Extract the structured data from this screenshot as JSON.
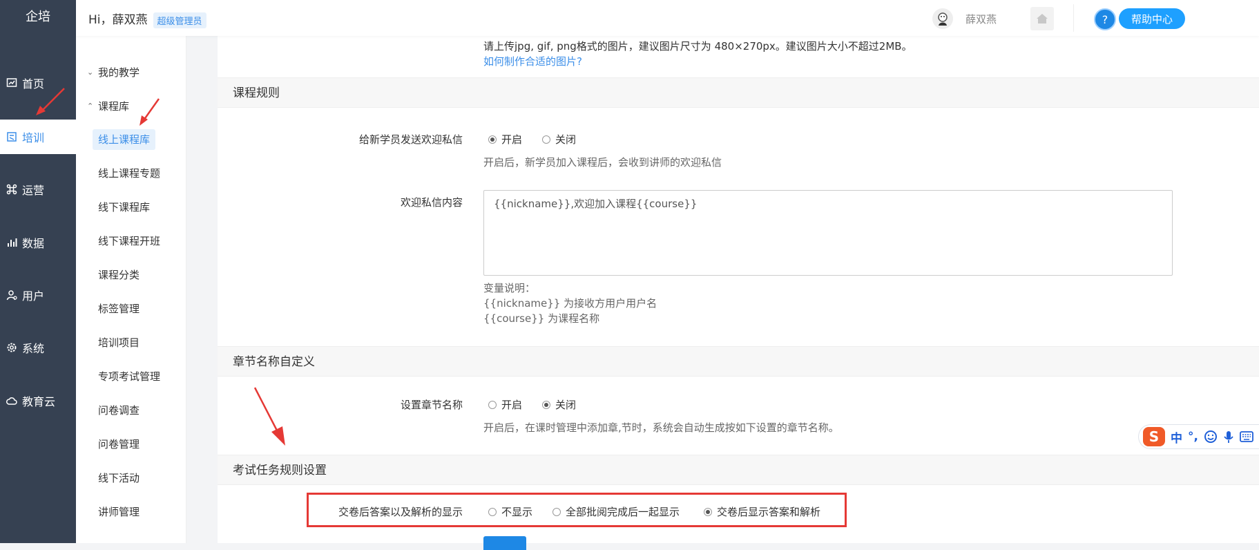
{
  "brand": "企培",
  "header": {
    "greeting": "Hi，薛双燕",
    "role_badge": "超级管理员",
    "username": "薛双燕",
    "help_label": "帮助中心",
    "help_icon": "?"
  },
  "leftnav": [
    {
      "label": "首页",
      "icon": "chart-icon"
    },
    {
      "label": "培训",
      "icon": "book-icon",
      "active": true
    },
    {
      "label": "运营",
      "icon": "command-icon"
    },
    {
      "label": "数据",
      "icon": "bar-chart-icon"
    },
    {
      "label": "用户",
      "icon": "user-gear-icon"
    },
    {
      "label": "系统",
      "icon": "gear-icon"
    },
    {
      "label": "教育云",
      "icon": "cloud-icon"
    }
  ],
  "subnav": {
    "groups": [
      {
        "label": "我的教学",
        "chevron": "⌄"
      },
      {
        "label": "课程库",
        "chevron": "⌃"
      }
    ],
    "items": [
      "线上课程库",
      "线上课程专题",
      "线下课程库",
      "线下课程开班",
      "课程分类",
      "标签管理",
      "培训项目",
      "专项考试管理",
      "问卷调查",
      "问卷管理",
      "线下活动",
      "讲师管理"
    ]
  },
  "main": {
    "upload_hint": "请上传jpg, gif, png格式的图片，建议图片尺寸为 480×270px。建议图片大小不超过2MB。",
    "upload_link": "如何制作合适的图片?",
    "course_rules": {
      "title": "课程规则",
      "welcome_label": "给新学员发送欢迎私信",
      "options": [
        "开启",
        "关闭"
      ],
      "welcome_selected": "开启",
      "welcome_hint": "开启后，新学员加入课程后，会收到讲师的欢迎私信",
      "content_label": "欢迎私信内容",
      "content_value": "{{nickname}},欢迎加入课程{{course}}",
      "var_title": "变量说明：",
      "var_nickname": "{{nickname}} 为接收方用户用户名",
      "var_course": "{{course}} 为课程名称"
    },
    "chapter": {
      "title": "章节名称自定义",
      "label": "设置章节名称",
      "options": [
        "开启",
        "关闭"
      ],
      "selected": "关闭",
      "hint": "开启后，在课时管理中添加章,节时，系统会自动生成按如下设置的章节名称。"
    },
    "exam": {
      "title": "考试任务规则设置",
      "label": "交卷后答案以及解析的显示",
      "options": [
        "不显示",
        "全部批阅完成后一起显示",
        "交卷后显示答案和解析"
      ],
      "selected": "交卷后显示答案和解析"
    }
  },
  "ime": {
    "logo": "S",
    "lang": "中",
    "punct": "°,"
  },
  "colors": {
    "accent": "#3b8ee8",
    "sidebar": "#364152",
    "highlight": "#e53935"
  }
}
